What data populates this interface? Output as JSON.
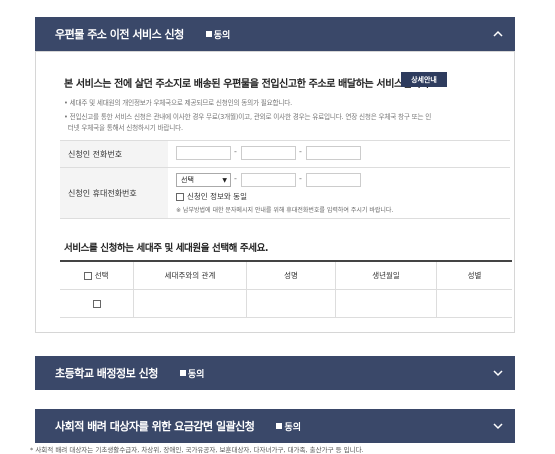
{
  "sections": [
    {
      "title": "우편물 주소 이전 서비스 신청",
      "agree": "동의",
      "expanded": true
    },
    {
      "title": "초등학교 배정정보 신청",
      "agree": "동의",
      "expanded": false
    },
    {
      "title": "사회적 배려 대상자를 위한 요금감면 일괄신청",
      "agree": "동의",
      "expanded": false
    }
  ],
  "mail": {
    "intro": "본 서비스는 전에 살던 주소지로 배송된 우편물을 전입신고한 주소로 배달하는 서비스입니다.",
    "detail_button": "상세안내",
    "note1": "세대주 및 세대원의 개인정보가 우체국으로 제공되므로 신청인의 동의가 필요합니다.",
    "note2_line1": "전입신고를 통한 서비스 신청은 관내에 이사한 경우 무료(3개월)이고, 관외로 이사한 경우는 유료입니다. 연장 신청은 우체국 창구 또는 인",
    "note2_line2": "터넷 우체국을 통해서 신청하시기 바랍니다.",
    "phone_label": "신청인 전화번호",
    "mobile_label": "신청인 휴대전화번호",
    "dash": "-",
    "mobile_select": "선택",
    "same_as_applicant": "신청인 정보와 동일",
    "mobile_note": "※ 납부방법에 대한 문자메시지 안내를 위해 휴대전화번호를 입력하여 주시기 바랍니다.",
    "select_title": "서비스를 신청하는 세대주 및 세대원을 선택해 주세요.",
    "table_headers": {
      "select": "선택",
      "relation": "세대주와의 관계",
      "name": "성명",
      "birth": "생년월일",
      "gender": "성별"
    }
  },
  "footnote": "* 사회적 배려 대상자는 기초생활수급자, 차상위, 장애인, 국가유공자, 보훈대상자, 다자녀가구, 대가족, 출산가구 등 입니다."
}
